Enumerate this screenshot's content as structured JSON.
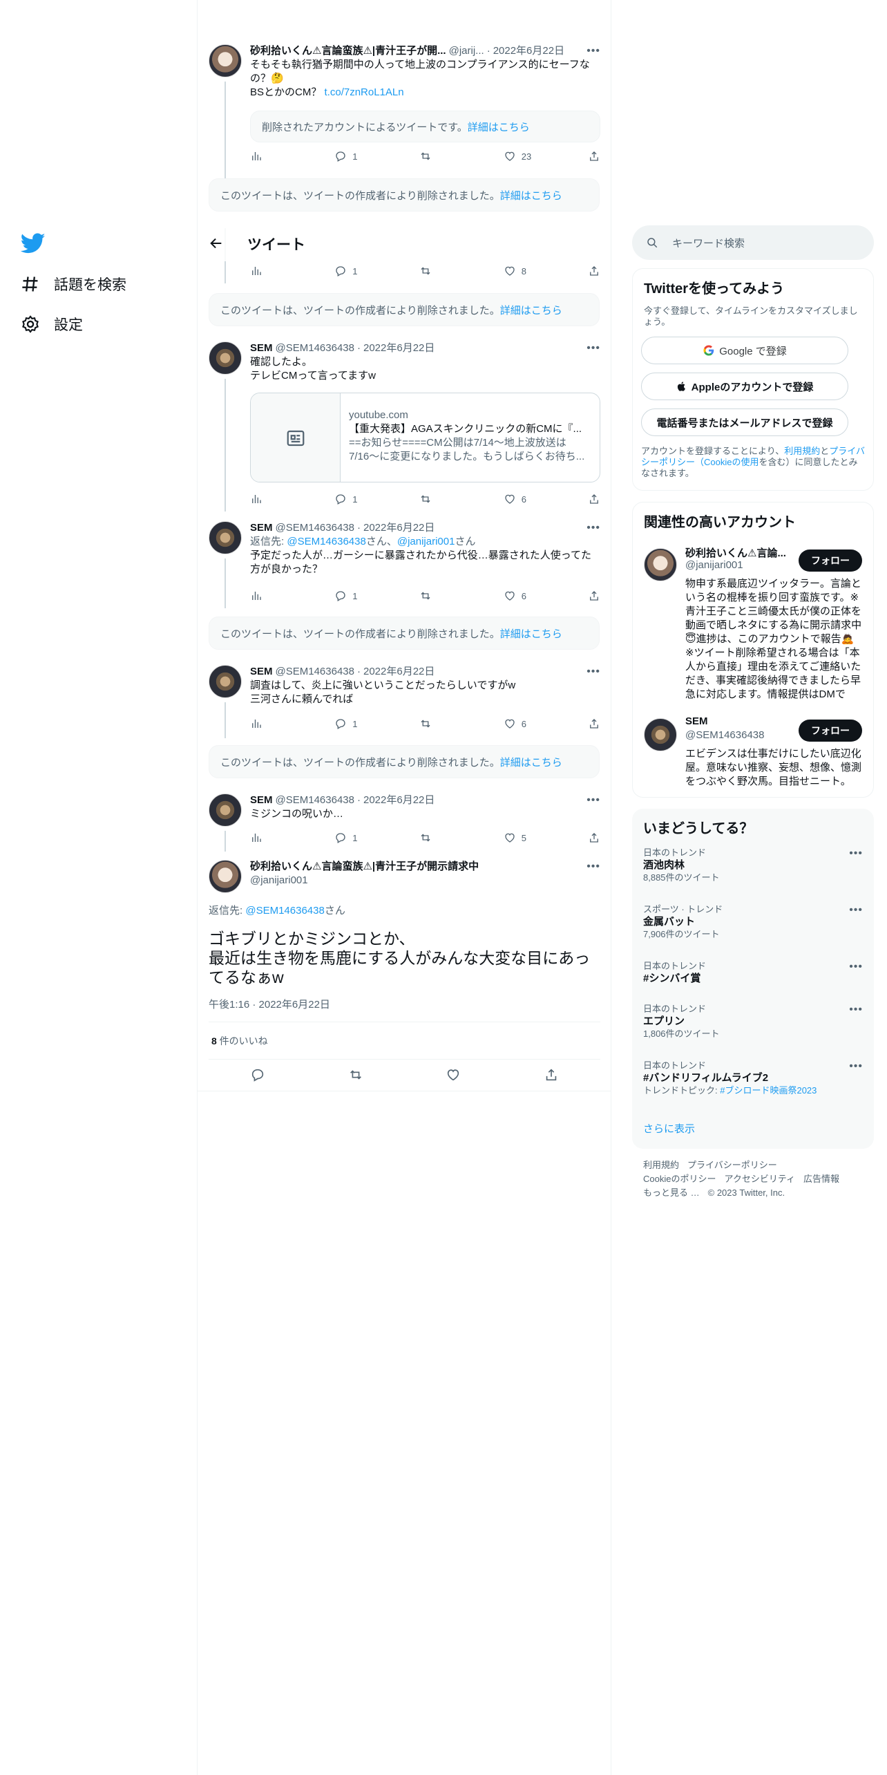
{
  "nav": {
    "explore_label": "話題を検索",
    "settings_label": "設定"
  },
  "header": {
    "title": "ツイート"
  },
  "thread": {
    "t1": {
      "name": "砂利拾いくん⚠言論蛮族⚠|青汁王子が開...",
      "handle": "@jarij...",
      "date": "2022年6月22日",
      "text": "そもそも執行猶予期間中の人って地上波のコンプライアンス的にセーフなの？🤔\nBSとかのCM？ ",
      "link": "t.co/7znRoL1ALn",
      "quote_deleted": "削除されたアカウントによるツイートです。",
      "quote_more": "詳細はこちら",
      "replies": "1",
      "retweets": "",
      "likes": "23"
    },
    "deleted_text": "このツイートは、ツイートの作成者により削除されました。",
    "deleted_more": "詳細はこちら",
    "t2": {
      "replies": "1",
      "likes": "8"
    },
    "t3": {
      "name": "SEM",
      "handle": "@SEM14636438",
      "date": "2022年6月22日",
      "text": "確認したよ。\nテレビCMって言ってますw",
      "card_domain": "youtube.com",
      "card_title": "【重大発表】AGAスキンクリニックの新CMに『...",
      "card_desc": "==お知らせ====CM公開は7/14〜地上波放送は7/16〜に変更になりました。もうしばらくお待ち...",
      "replies": "1",
      "likes": "6"
    },
    "t4": {
      "name": "SEM",
      "handle": "@SEM14636438",
      "date": "2022年6月22日",
      "reply_prefix": "返信先: ",
      "reply_to1": "@SEM14636438",
      "reply_mid": "さん、",
      "reply_to2": "@janijari001",
      "reply_suffix": "さん",
      "text": "予定だった人が…ガーシーに暴露されたから代役…暴露された人使ってた方が良かった？",
      "replies": "1",
      "likes": "6"
    },
    "t5": {
      "name": "SEM",
      "handle": "@SEM14636438",
      "date": "2022年6月22日",
      "text": "調査はして、炎上に強いということだったらしいですがw\n三河さんに頼んでれば",
      "replies": "1",
      "likes": "6"
    },
    "t6": {
      "name": "SEM",
      "handle": "@SEM14636438",
      "date": "2022年6月22日",
      "text": "ミジンコの呪いか…",
      "replies": "1",
      "likes": "5"
    },
    "focus": {
      "name": "砂利拾いくん⚠言論蛮族⚠|青汁王子が開示請求中",
      "handle": "@janijari001",
      "reply_prefix": "返信先: ",
      "reply_to": "@SEM14636438",
      "reply_suffix": "さん",
      "text": "ゴキブリとかミジンコとか、\n最近は生き物を馬鹿にする人がみんな大変な目にあってるなぁw",
      "time": "午後1:16 · 2022年6月22日",
      "like_count": "8",
      "like_label": " 件のいいね"
    }
  },
  "right": {
    "search_placeholder": "キーワード検索",
    "signup": {
      "title": "Twitterを使ってみよう",
      "sub": "今すぐ登録して、タイムラインをカスタマイズしましょう。",
      "google": "Google で登録",
      "apple": "Appleのアカウントで登録",
      "phone": "電話番号またはメールアドレスで登録",
      "legal_pre": "アカウントを登録することにより、",
      "legal_terms": "利用規約",
      "legal_and": "と",
      "legal_privacy": "プライバシーポリシー（Cookieの使用",
      "legal_post": "を含む）に同意したとみなされます。"
    },
    "related": {
      "title": "関連性の高いアカウント",
      "a1_name": "砂利拾いくん⚠言論...",
      "a1_handle": "@janijari001",
      "a1_bio": "物申す系最底辺ツイッタラー。言論という名の棍棒を振り回す蛮族です。※青汁王子こと三崎優太氏が僕の正体を動画で晒しネタにする為に開示請求中😇進捗は、このアカウントで報告🙇※ツイート削除希望される場合は「本人から直接」理由を添えてご連絡いただき、事実確認後納得できましたら早急に対応します。情報提供はDMで",
      "a2_name": "SEM",
      "a2_handle": "@SEM14636438",
      "a2_bio": "エビデンスは仕事だけにしたい底辺化屋。意味ない推察、妄想、想像、憶測をつぶやく野次馬。目指せニート。",
      "follow_label": "フォロー"
    },
    "trends": {
      "title": "いまどうしてる？",
      "items": [
        {
          "ctx": "日本のトレンド",
          "name": "酒池肉林",
          "count": "8,885件のツイート"
        },
        {
          "ctx": "スポーツ · トレンド",
          "name": "金属バット",
          "count": "7,906件のツイート"
        },
        {
          "ctx": "日本のトレンド",
          "name": "#シンバイ賞",
          "count": ""
        },
        {
          "ctx": "日本のトレンド",
          "name": "エプリン",
          "count": "1,806件のツイート"
        },
        {
          "ctx": "日本のトレンド",
          "name": "#バンドリフィルムライブ2",
          "count": "トレンドトピック: ",
          "topic": "#ブシロード映画祭2023"
        }
      ],
      "show_more": "さらに表示"
    },
    "footer": {
      "terms": "利用規約",
      "privacy": "プライバシーポリシー",
      "cookie": "Cookieのポリシー",
      "accessibility": "アクセシビリティ",
      "ads": "広告情報",
      "more": "もっと見る …",
      "copyright": "© 2023 Twitter, Inc."
    }
  },
  "colors": {
    "accent": "#1d9bf0",
    "text": "#0f1419",
    "muted": "#536471",
    "border": "#eff3f4"
  }
}
